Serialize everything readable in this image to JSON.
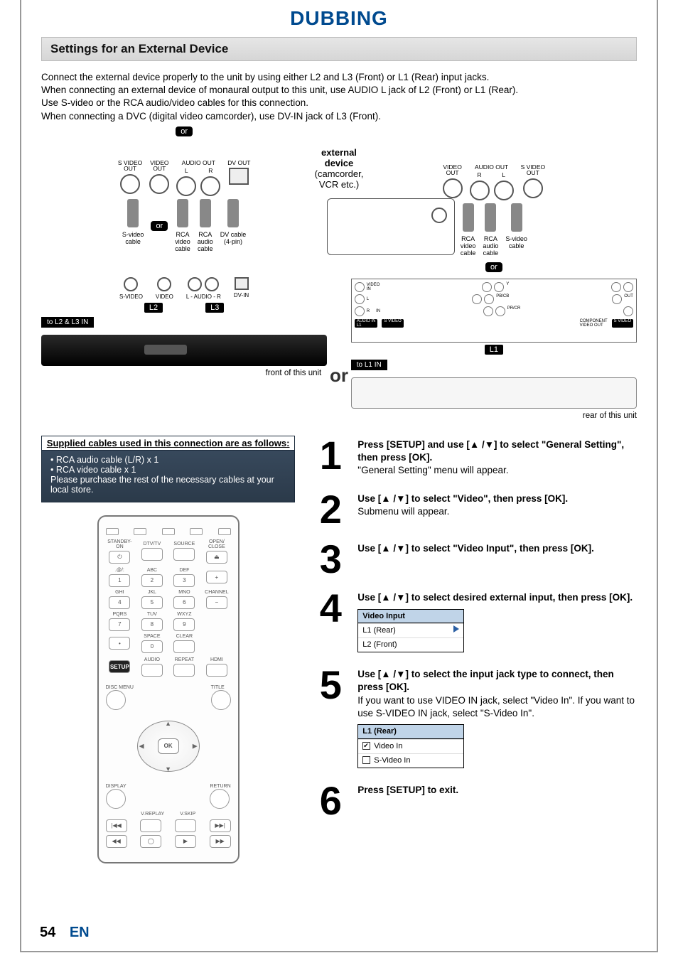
{
  "title": "DUBBING",
  "section_heading": "Settings for an External Device",
  "intro": [
    "Connect the external device properly to the unit by using either L2 and L3 (Front) or L1 (Rear) input jacks.",
    "When connecting an external device of monaural output to this unit, use AUDIO L jack of L2 (Front) or L1 (Rear).",
    "Use S-video or the RCA audio/video cables for this connection.",
    "When connecting a DVC (digital video camcorder), use DV-IN jack of L3 (Front)."
  ],
  "or_label": "or",
  "center_or": "or",
  "ports_left": {
    "svideo_out": "S VIDEO\nOUT",
    "video_out": "VIDEO\nOUT",
    "audio_out": "AUDIO OUT",
    "audio_l": "L",
    "audio_r": "R",
    "dv_out": "DV OUT"
  },
  "ports_right": {
    "video_out": "VIDEO\nOUT",
    "audio_out": "AUDIO OUT",
    "audio_r": "R",
    "audio_l": "L",
    "svideo_out": "S VIDEO\nOUT"
  },
  "cables_left": {
    "svideo": "S-video\ncable",
    "rca_video": "RCA\nvideo\ncable",
    "rca_audio": "RCA\naudio\ncable",
    "dv": "DV cable\n(4-pin)"
  },
  "cables_right": {
    "rca_video": "RCA\nvideo\ncable",
    "rca_audio": "RCA\naudio\ncable",
    "svideo": "S-video\ncable"
  },
  "front_labels": {
    "svideo": "S-VIDEO",
    "video": "VIDEO",
    "audio_lr": "L - AUDIO - R",
    "dvin": "DV-IN",
    "l2": "L2",
    "l3": "L3",
    "to": "to L2 & L3 IN",
    "caption": "front of this unit"
  },
  "rear_labels": {
    "video_in": "VIDEO\nIN",
    "l": "L",
    "r": "R",
    "in": "IN",
    "audio_in_l1": "AUDIO IN\nL1",
    "svideo": "S VIDEO",
    "component_out": "COMPONENT\nVIDEO OUT",
    "out": "OUT",
    "pb_cb": "PB/CB",
    "pr_cr": "PR/CR",
    "y": "Y",
    "l1": "L1",
    "to": "to L1 IN",
    "caption": "rear of this unit"
  },
  "ext_device": {
    "title": "external device",
    "sub": "(camcorder, VCR etc.)"
  },
  "supplied": {
    "heading": "Supplied cables used in this connection are as follows:",
    "items": [
      "• RCA audio cable (L/R) x 1",
      "• RCA video cable x 1"
    ],
    "note": "Please purchase the rest of the necessary cables at your local store."
  },
  "remote": {
    "row1": [
      "STANDBY-ON",
      "DTV/TV",
      "SOURCE",
      "OPEN/\nCLOSE"
    ],
    "keypad": [
      {
        "sub": ".@/:",
        "num": "1"
      },
      {
        "sub": "ABC",
        "num": "2"
      },
      {
        "sub": "DEF",
        "num": "3"
      },
      {
        "sub": "",
        "num": "+"
      },
      {
        "sub": "GHI",
        "num": "4"
      },
      {
        "sub": "JKL",
        "num": "5"
      },
      {
        "sub": "MNO",
        "num": "6"
      },
      {
        "sub": "CHANNEL",
        "num": "−"
      },
      {
        "sub": "PQRS",
        "num": "7"
      },
      {
        "sub": "TUV",
        "num": "8"
      },
      {
        "sub": "WXYZ",
        "num": "9"
      },
      {
        "sub": "",
        "num": ""
      },
      {
        "sub": "",
        "num": "•"
      },
      {
        "sub": "SPACE",
        "num": "0"
      },
      {
        "sub": "CLEAR",
        "num": ""
      },
      {
        "sub": "",
        "num": ""
      }
    ],
    "row3": [
      "SETUP",
      "AUDIO",
      "REPEAT",
      "HDMI"
    ],
    "disc_menu": "DISC MENU",
    "title": "TITLE",
    "display": "DISPLAY",
    "return": "RETURN",
    "ok": "OK",
    "vreplay": "V.REPLAY",
    "vskip": "V.SKIP",
    "transport": [
      "|◀◀",
      "",
      "",
      "▶▶|"
    ],
    "transport2": [
      "◀◀",
      "◯",
      "▶",
      "▶▶"
    ]
  },
  "steps": [
    {
      "n": "1",
      "bold": "Press [SETUP] and use [▲ /▼] to select \"General Setting\", then press [OK].",
      "rest": "\"General Setting\" menu will appear."
    },
    {
      "n": "2",
      "bold": "Use [▲ /▼] to select \"Video\", then press [OK].",
      "rest": "Submenu will appear."
    },
    {
      "n": "3",
      "bold": "Use [▲ /▼] to select \"Video Input\", then press [OK].",
      "rest": ""
    },
    {
      "n": "4",
      "bold": "Use [▲ /▼] to select desired external input, then press [OK].",
      "rest": "",
      "osd": {
        "title": "Video Input",
        "rows": [
          "L1 (Rear)",
          "L2 (Front)"
        ]
      }
    },
    {
      "n": "5",
      "bold": "Use [▲ /▼] to select the input jack type to connect, then press [OK].",
      "rest": "If you want to use VIDEO IN jack, select \"Video In\". If you want to use S-VIDEO IN jack, select \"S-Video In\".",
      "osd2": {
        "title": "L1 (Rear)",
        "rows": [
          {
            "check": true,
            "label": "Video In"
          },
          {
            "check": false,
            "label": "S-Video In"
          }
        ]
      }
    },
    {
      "n": "6",
      "bold": "Press [SETUP] to exit.",
      "rest": ""
    }
  ],
  "footer": {
    "page": "54",
    "lang": "EN"
  }
}
